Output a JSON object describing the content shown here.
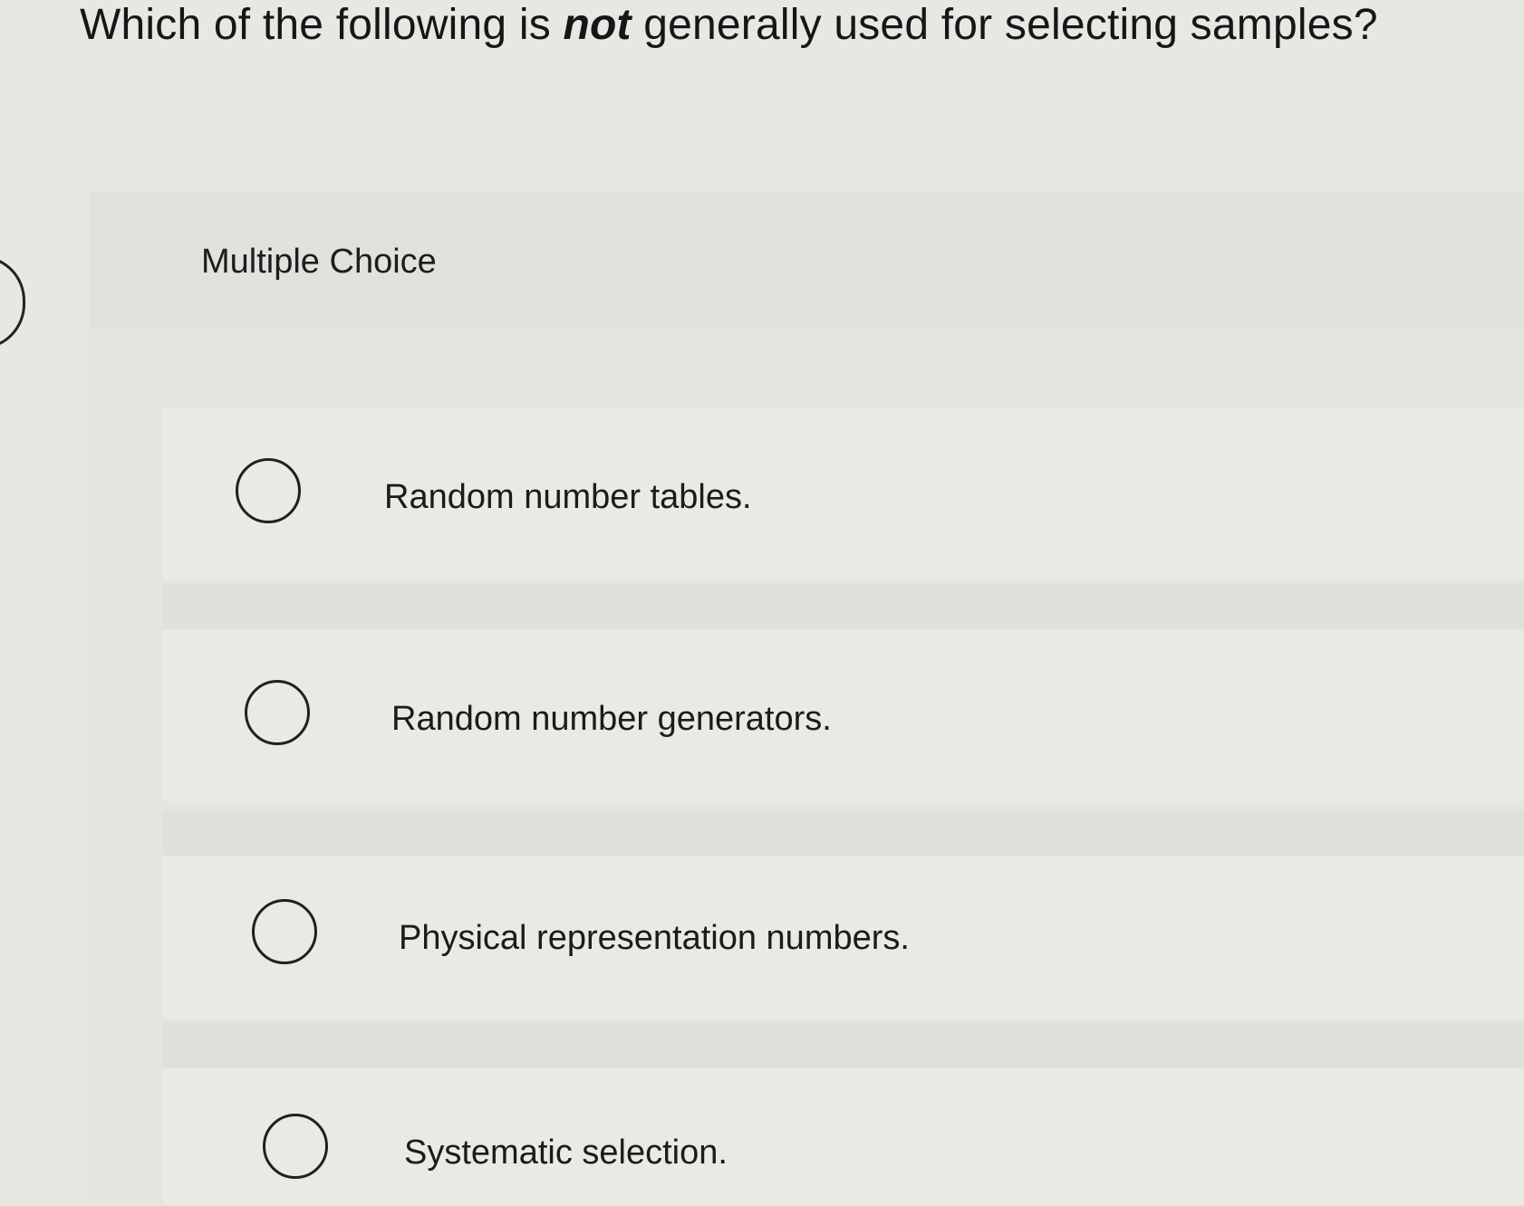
{
  "question": {
    "prefix": "Which of the following is ",
    "emphasis": "not",
    "suffix": " generally used for selecting samples?"
  },
  "question_type": "Multiple Choice",
  "options": [
    {
      "label": "Random number tables.",
      "selected": false
    },
    {
      "label": "Random number generators.",
      "selected": false
    },
    {
      "label": "Physical representation numbers.",
      "selected": false
    },
    {
      "label": "Systematic selection.",
      "selected": false
    }
  ]
}
